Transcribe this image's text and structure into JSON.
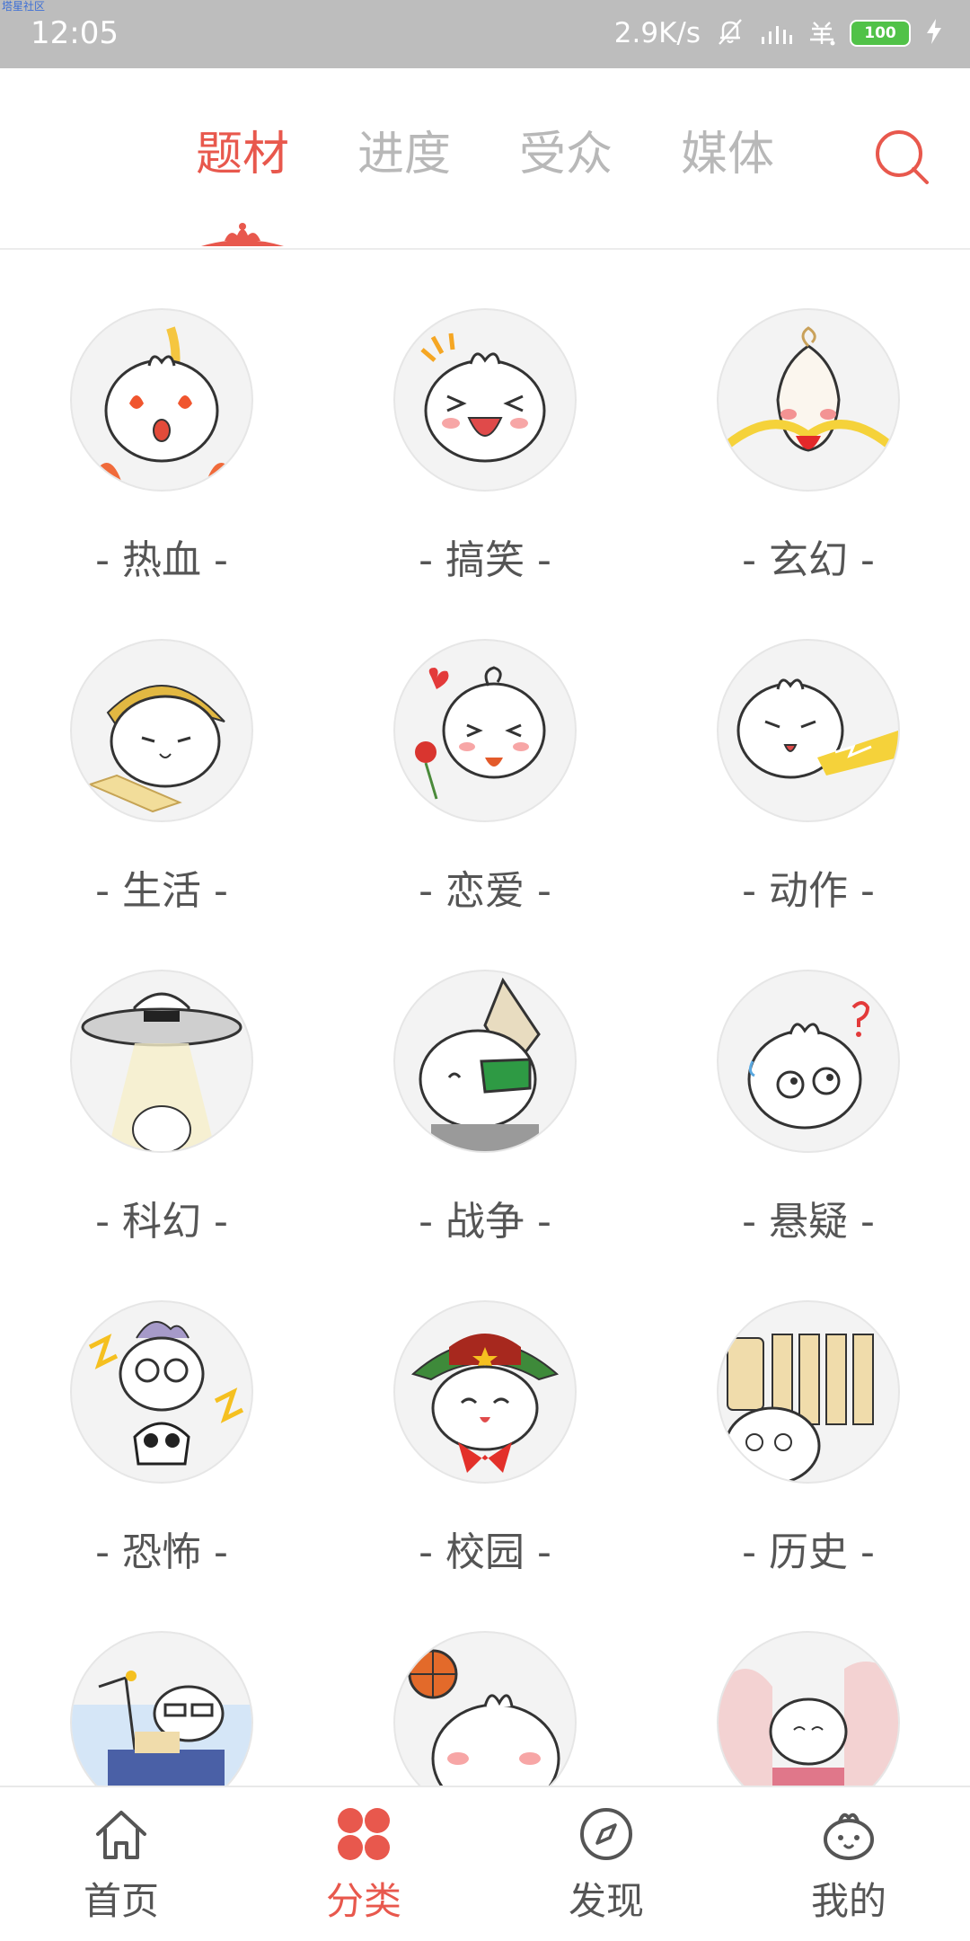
{
  "status_bar": {
    "watermark": "塔星社区",
    "time": "12:05",
    "net_speed": "2.9K/s",
    "battery_level": "100"
  },
  "top_tabs": {
    "items": [
      {
        "label": "题材",
        "active": true
      },
      {
        "label": "进度",
        "active": false
      },
      {
        "label": "受众",
        "active": false
      },
      {
        "label": "媒体",
        "active": false
      }
    ],
    "search_icon": "search-icon"
  },
  "categories": [
    {
      "label": "- 热血 -",
      "icon": "hot-blooded-bun-icon"
    },
    {
      "label": "- 搞笑 -",
      "icon": "funny-bun-icon"
    },
    {
      "label": "- 玄幻 -",
      "icon": "fantasy-bun-icon"
    },
    {
      "label": "- 生活 -",
      "icon": "life-bun-icon"
    },
    {
      "label": "- 恋爱 -",
      "icon": "romance-bun-icon"
    },
    {
      "label": "- 动作 -",
      "icon": "action-bun-icon"
    },
    {
      "label": "- 科幻 -",
      "icon": "scifi-bun-icon"
    },
    {
      "label": "- 战争 -",
      "icon": "war-bun-icon"
    },
    {
      "label": "- 悬疑 -",
      "icon": "mystery-bun-icon"
    },
    {
      "label": "- 恐怖 -",
      "icon": "horror-bun-icon"
    },
    {
      "label": "- 校园 -",
      "icon": "campus-bun-icon"
    },
    {
      "label": "- 历史 -",
      "icon": "history-bun-icon"
    },
    {
      "label": "",
      "icon": "city-bun-icon"
    },
    {
      "label": "",
      "icon": "sports-bun-icon"
    },
    {
      "label": "",
      "icon": "ancient-bun-icon"
    }
  ],
  "bottom_nav": {
    "items": [
      {
        "label": "首页",
        "icon": "home-icon",
        "active": false
      },
      {
        "label": "分类",
        "icon": "category-icon",
        "active": true
      },
      {
        "label": "发现",
        "icon": "compass-icon",
        "active": false
      },
      {
        "label": "我的",
        "icon": "profile-icon",
        "active": false
      }
    ]
  },
  "colors": {
    "accent": "#e8584d",
    "inactive_tab": "#b8b8b8",
    "label_text": "#555555",
    "status_bar_bg": "#bdbdbd",
    "battery_green": "#51c248"
  }
}
